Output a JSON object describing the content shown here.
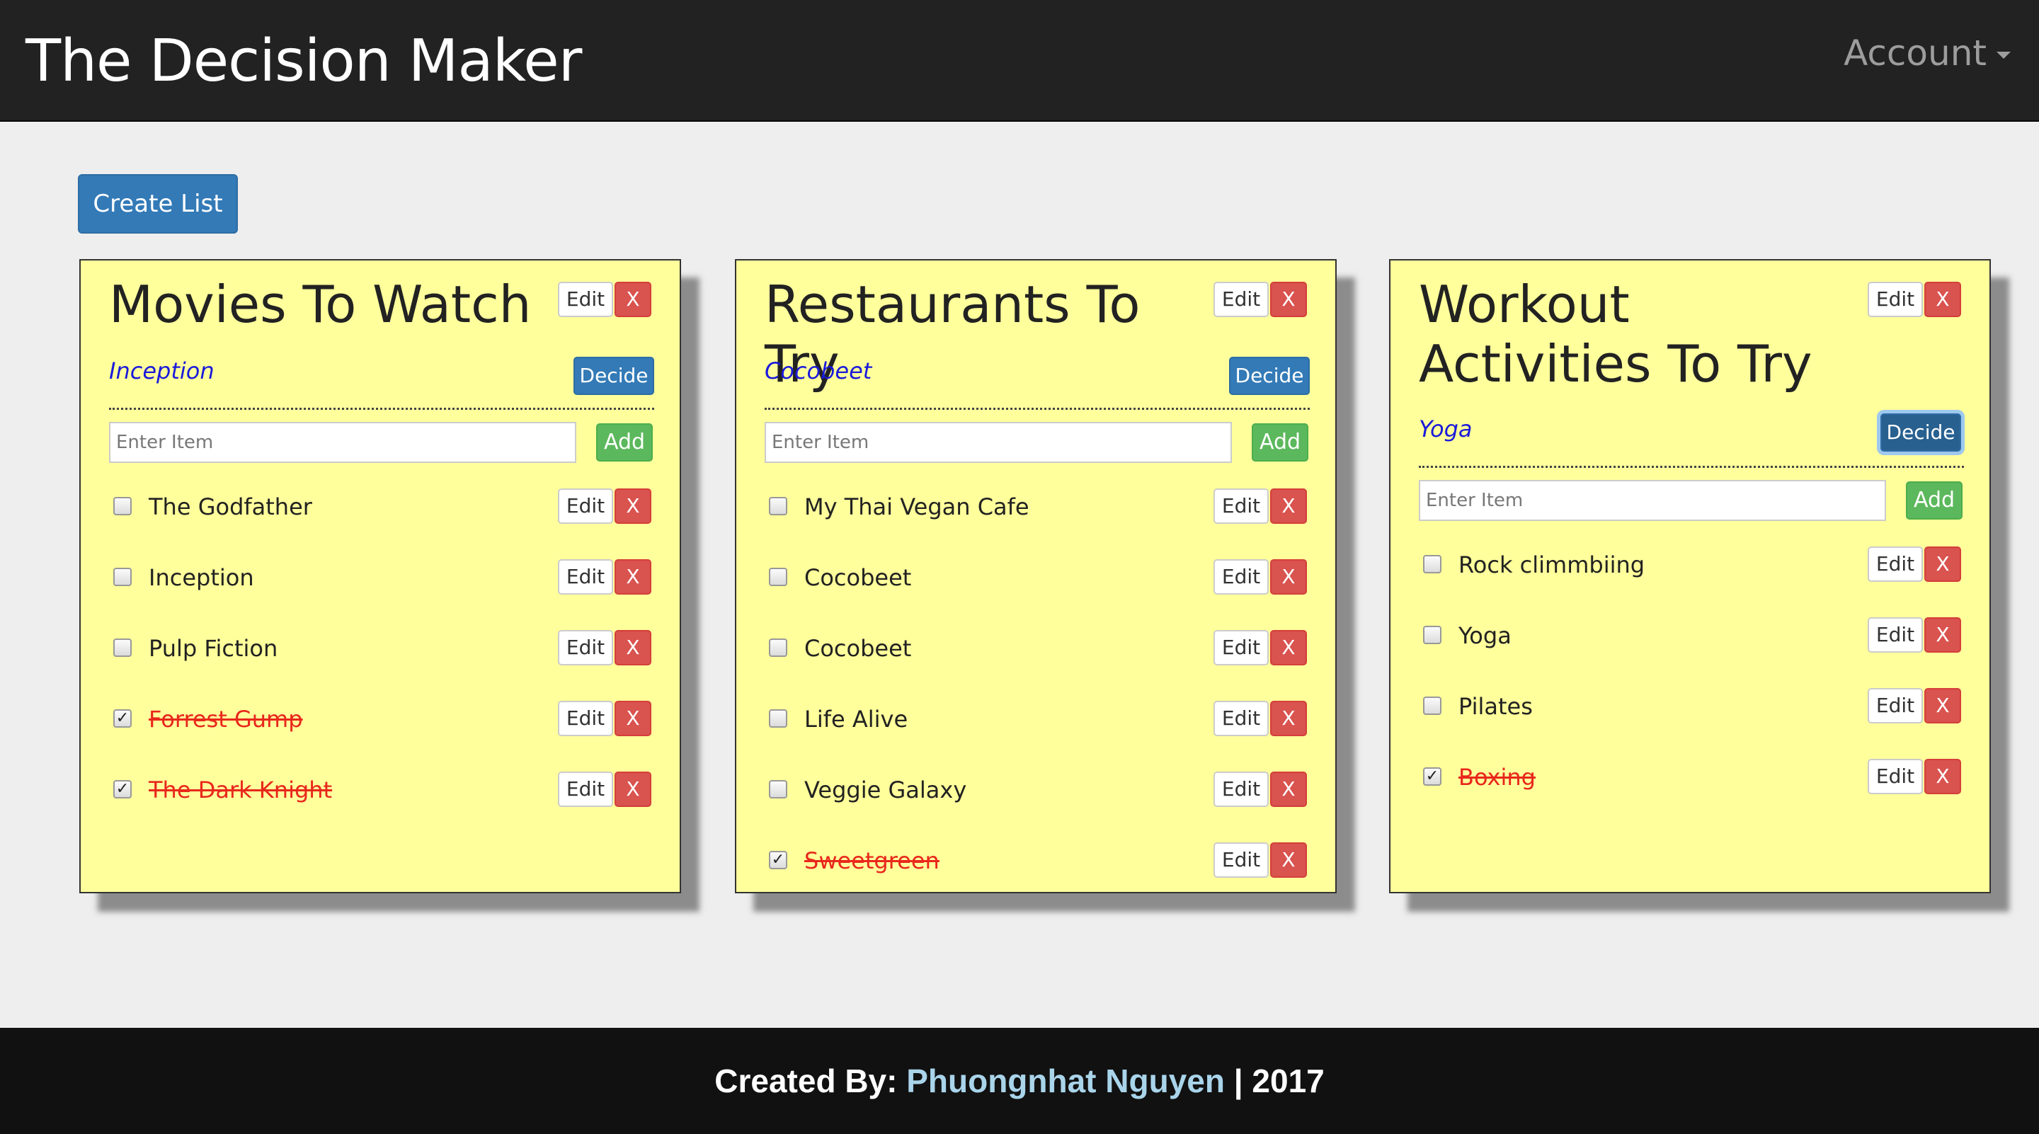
{
  "navbar": {
    "brand": "The Decision Maker",
    "account_label": "Account"
  },
  "create_button": "Create List",
  "input_placeholder": "Enter Item",
  "labels": {
    "edit": "Edit",
    "delete": "X",
    "decide": "Decide",
    "add": "Add"
  },
  "lists": [
    {
      "title": "Movies To Watch",
      "selected": "Inception",
      "items": [
        {
          "label": "The Godfather",
          "checked": false
        },
        {
          "label": "Inception",
          "checked": false
        },
        {
          "label": "Pulp Fiction",
          "checked": false
        },
        {
          "label": "Forrest Gump",
          "checked": true
        },
        {
          "label": "The Dark Knight",
          "checked": true
        }
      ]
    },
    {
      "title": "Restaurants To Try",
      "selected": "Cocobeet",
      "items": [
        {
          "label": "My Thai Vegan Cafe",
          "checked": false
        },
        {
          "label": "Cocobeet",
          "checked": false
        },
        {
          "label": "Cocobeet",
          "checked": false
        },
        {
          "label": "Life Alive",
          "checked": false
        },
        {
          "label": "Veggie Galaxy",
          "checked": false
        },
        {
          "label": "Sweetgreen",
          "checked": true
        }
      ]
    },
    {
      "title": "Workout Activities To Try",
      "selected": "Yoga",
      "items": [
        {
          "label": "Rock climmbiing",
          "checked": false
        },
        {
          "label": "Yoga",
          "checked": false
        },
        {
          "label": "Pilates",
          "checked": false
        },
        {
          "label": "Boxing",
          "checked": true
        }
      ]
    }
  ],
  "footer": {
    "prefix": "Created By: ",
    "author": "Phuongnhat Nguyen",
    "suffix": " | 2017"
  }
}
